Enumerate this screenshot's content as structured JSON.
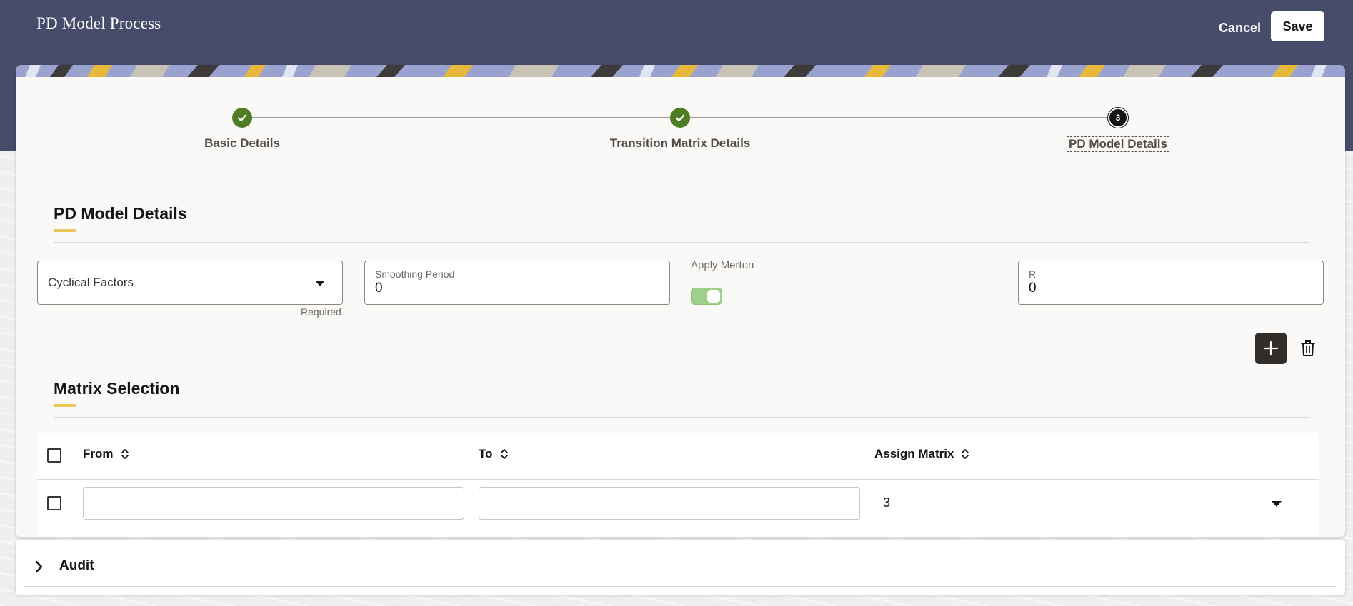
{
  "header": {
    "title": "PD Model Process",
    "cancel_label": "Cancel",
    "save_label": "Save"
  },
  "train": {
    "steps": [
      {
        "label": "Basic Details",
        "status": "done"
      },
      {
        "label": "Transition Matrix Details",
        "status": "done"
      },
      {
        "label": "PD Model Details",
        "status": "current",
        "number": "3"
      }
    ]
  },
  "pd_model": {
    "section_title": "PD Model Details",
    "cyclical_factors": {
      "value": "Cyclical Factors",
      "helper": "Required"
    },
    "smoothing_period": {
      "label": "Smoothing Period",
      "value": "0"
    },
    "apply_merton": {
      "label": "Apply Merton",
      "on": true
    },
    "r": {
      "label": "R",
      "value": "0"
    }
  },
  "matrix_selection": {
    "section_title": "Matrix Selection",
    "columns": [
      "From",
      "To",
      "Assign Matrix"
    ],
    "rows": [
      {
        "from": "",
        "to": "",
        "assign_matrix": "3"
      }
    ]
  },
  "audit": {
    "title": "Audit"
  },
  "colors": {
    "header_bg": "#474c6b",
    "step_done": "#4f7d23",
    "accent_underline": "#e8c85a",
    "switch_on": "#9fd08a"
  }
}
